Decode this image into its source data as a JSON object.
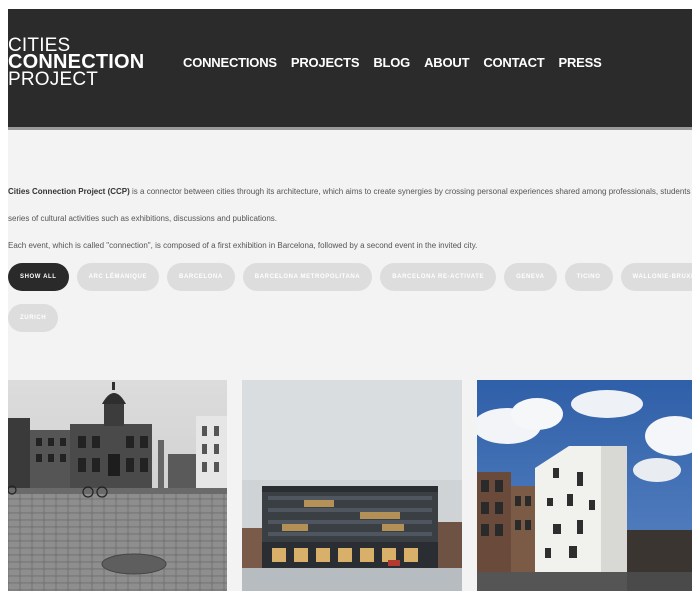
{
  "header": {
    "logo": {
      "line1": "CITIES",
      "line2": "CONNECTION",
      "line3": "PROJECT"
    },
    "nav": [
      "CONNECTIONS",
      "PROJECTS",
      "BLOG",
      "ABOUT",
      "CONTACT",
      "PRESS"
    ]
  },
  "intro": {
    "p1_strong": "Cities Connection Project (CCP)",
    "p1_rest": " is a connector between cities through its architecture, which aims to create synergies by crossing personal experiences shared among professionals, students and traders,",
    "p1_line2": "series of cultural activities such as exhibitions, discussions and publications.",
    "p2": "Each event, which is called \"connection\", is composed of a first exhibition in Barcelona, followed by a second event in the invited city."
  },
  "filters": {
    "row1": [
      "SHOW ALL",
      "ARC LÉMANIQUE",
      "BARCELONA",
      "BARCELONA METROPOLITANA",
      "BARCELONA RE-ACTIVATE",
      "GENEVA",
      "TICINO",
      "WALLONIE-BRUXELLES"
    ],
    "row2": [
      "ZURICH"
    ],
    "active": "SHOW ALL"
  },
  "colors": {
    "header_bg": "#2b2b2b",
    "page_bg": "#f3f3f3",
    "pill_bg": "#dddddd",
    "pill_active_bg": "#2a2a2a"
  }
}
